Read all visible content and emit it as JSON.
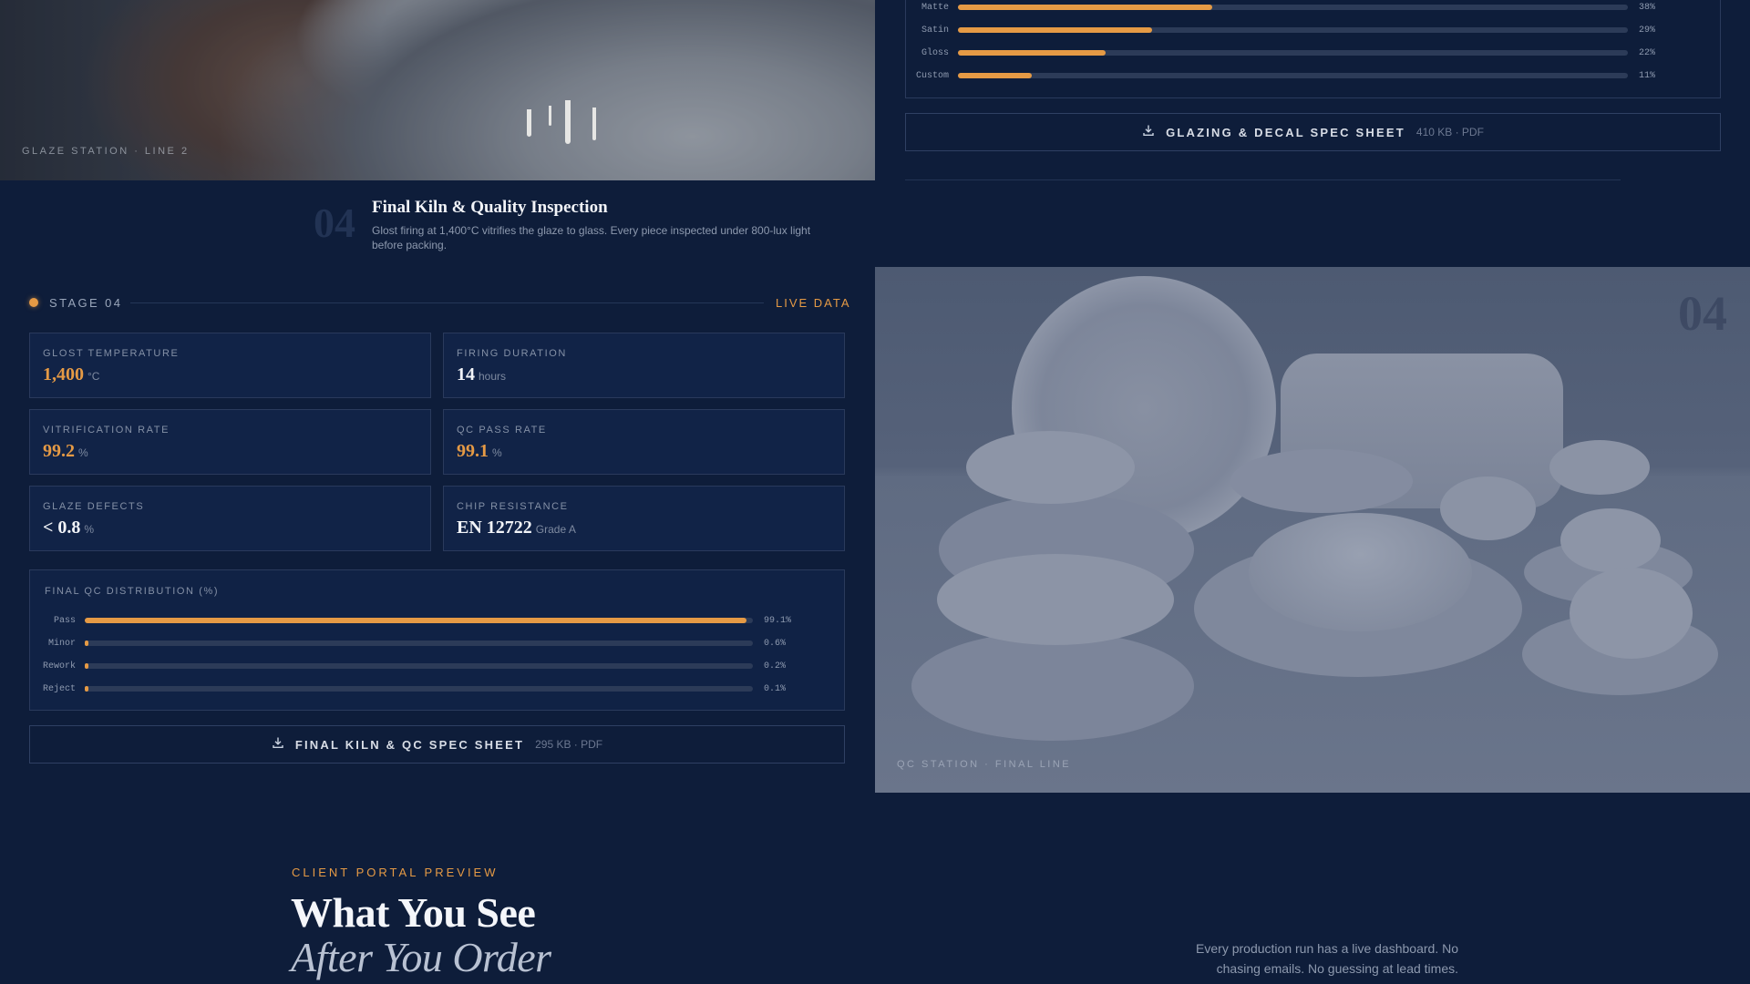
{
  "glaze_photo": {
    "caption": "GLAZE STATION · LINE 2"
  },
  "glaze_distribution": {
    "rows": [
      {
        "label": "Matte",
        "pct_label": "38%",
        "value": 0.38
      },
      {
        "label": "Satin",
        "pct_label": "29%",
        "value": 0.29
      },
      {
        "label": "Gloss",
        "pct_label": "22%",
        "value": 0.22
      },
      {
        "label": "Custom",
        "pct_label": "11%",
        "value": 0.11
      }
    ]
  },
  "glaze_download": {
    "label": "GLAZING & DECAL SPEC SHEET",
    "meta": "410 KB · PDF",
    "icon": "download-icon"
  },
  "section": {
    "number": "04",
    "title": "Final Kiln & Quality Inspection",
    "description": "Glost firing at 1,400°C vitrifies the glaze to glass. Every piece inspected under 800-lux light before packing."
  },
  "stage": {
    "label": "STAGE 04",
    "live": "LIVE DATA",
    "accent_color": "#e59a45"
  },
  "metrics": [
    {
      "label": "GLOST TEMPERATURE",
      "value": "1,400",
      "unit": "°C"
    },
    {
      "label": "FIRING DURATION",
      "value": "14",
      "unit": "hours"
    },
    {
      "label": "VITRIFICATION RATE",
      "value": "99.2",
      "unit": "%"
    },
    {
      "label": "QC PASS RATE",
      "value": "99.1",
      "unit": "%"
    },
    {
      "label": "GLAZE DEFECTS",
      "value": "< 0.8",
      "unit": "%"
    },
    {
      "label": "CHIP RESISTANCE",
      "value": "EN 12722",
      "unit": "Grade A"
    }
  ],
  "qc_distribution": {
    "title": "FINAL QC DISTRIBUTION (%)",
    "rows": [
      {
        "label": "Pass",
        "pct_label": "99.1%",
        "value": 0.991
      },
      {
        "label": "Minor",
        "pct_label": "0.6%",
        "value": 0.006
      },
      {
        "label": "Rework",
        "pct_label": "0.2%",
        "value": 0.002
      },
      {
        "label": "Reject",
        "pct_label": "0.1%",
        "value": 0.001
      }
    ]
  },
  "qc_download": {
    "label": "FINAL KILN & QC SPEC SHEET",
    "meta": "295 KB · PDF",
    "icon": "download-icon"
  },
  "qc_photo": {
    "number": "04",
    "caption": "QC STATION · FINAL LINE"
  },
  "client_portal": {
    "eyebrow": "CLIENT PORTAL PREVIEW",
    "title_line1": "What You See",
    "title_line2": "After You Order",
    "description": "Every production run has a live dashboard. No chasing emails. No guessing at lead times."
  }
}
